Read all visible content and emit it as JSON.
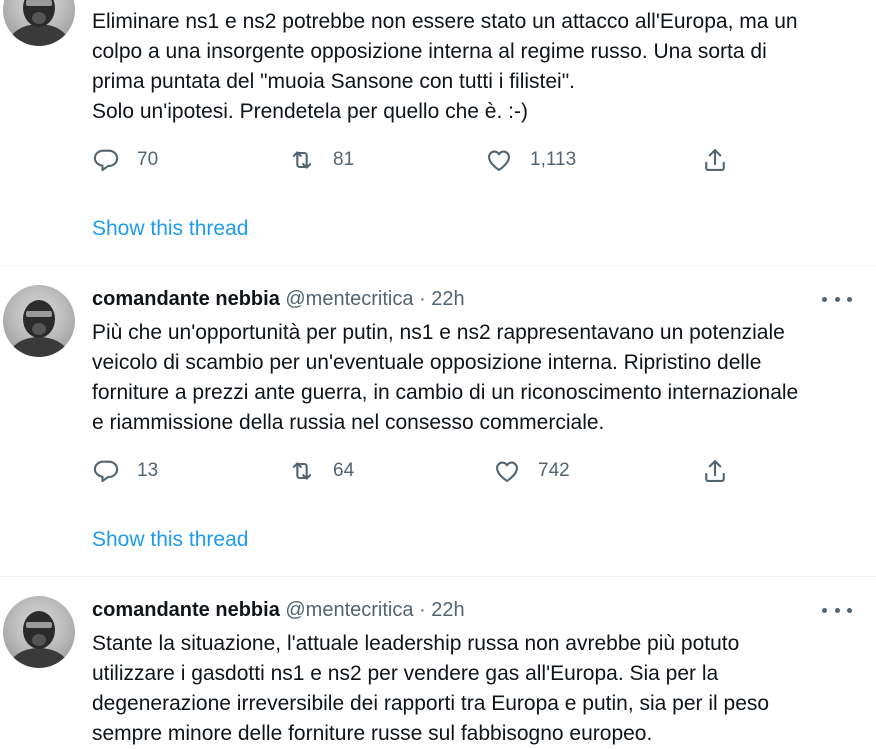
{
  "tweets": [
    {
      "author_name": "",
      "handle": "",
      "time": "",
      "text": "Eliminare ns1 e ns2 potrebbe non essere stato un attacco all'Europa, ma un\ncolpo a una insorgente opposizione interna al regime russo. Una sorta di\nprima puntata del \"muoia Sansone con tutti i filistei\".\nSolo un'ipotesi. Prendetela per quello che è. :-)",
      "replies": "70",
      "retweets": "81",
      "likes": "1,113",
      "show_thread": "Show this thread"
    },
    {
      "author_name": "comandante nebbia",
      "handle": "@mentecritica",
      "separator": "·",
      "time": "22h",
      "text": "Più che un'opportunità per putin, ns1 e ns2 rappresentavano un potenziale\nveicolo di scambio per un'eventuale opposizione interna. Ripristino delle\nforniture a prezzi ante guerra, in cambio di un riconoscimento internazionale\ne riammissione della russia nel consesso commerciale.",
      "replies": "13",
      "retweets": "64",
      "likes": "742",
      "show_thread": "Show this thread"
    },
    {
      "author_name": "comandante nebbia",
      "handle": "@mentecritica",
      "separator": "·",
      "time": "22h",
      "text": "Stante la situazione, l'attuale leadership russa non avrebbe più potuto\nutilizzare i gasdotti ns1 e ns2 per vendere gas all'Europa. Sia per la\ndegenerazione irreversibile dei rapporti tra Europa e putin, sia per il peso\nsempre minore delle forniture russe sul fabbisogno europeo."
    }
  ],
  "icons": {
    "reply": "reply-icon",
    "retweet": "retweet-icon",
    "like": "like-icon",
    "share": "share-icon",
    "more": "more-options-icon"
  },
  "colors": {
    "text": "#0f1419",
    "secondary": "#536471",
    "link": "#1d9bf0",
    "divider": "#eff3f4"
  }
}
